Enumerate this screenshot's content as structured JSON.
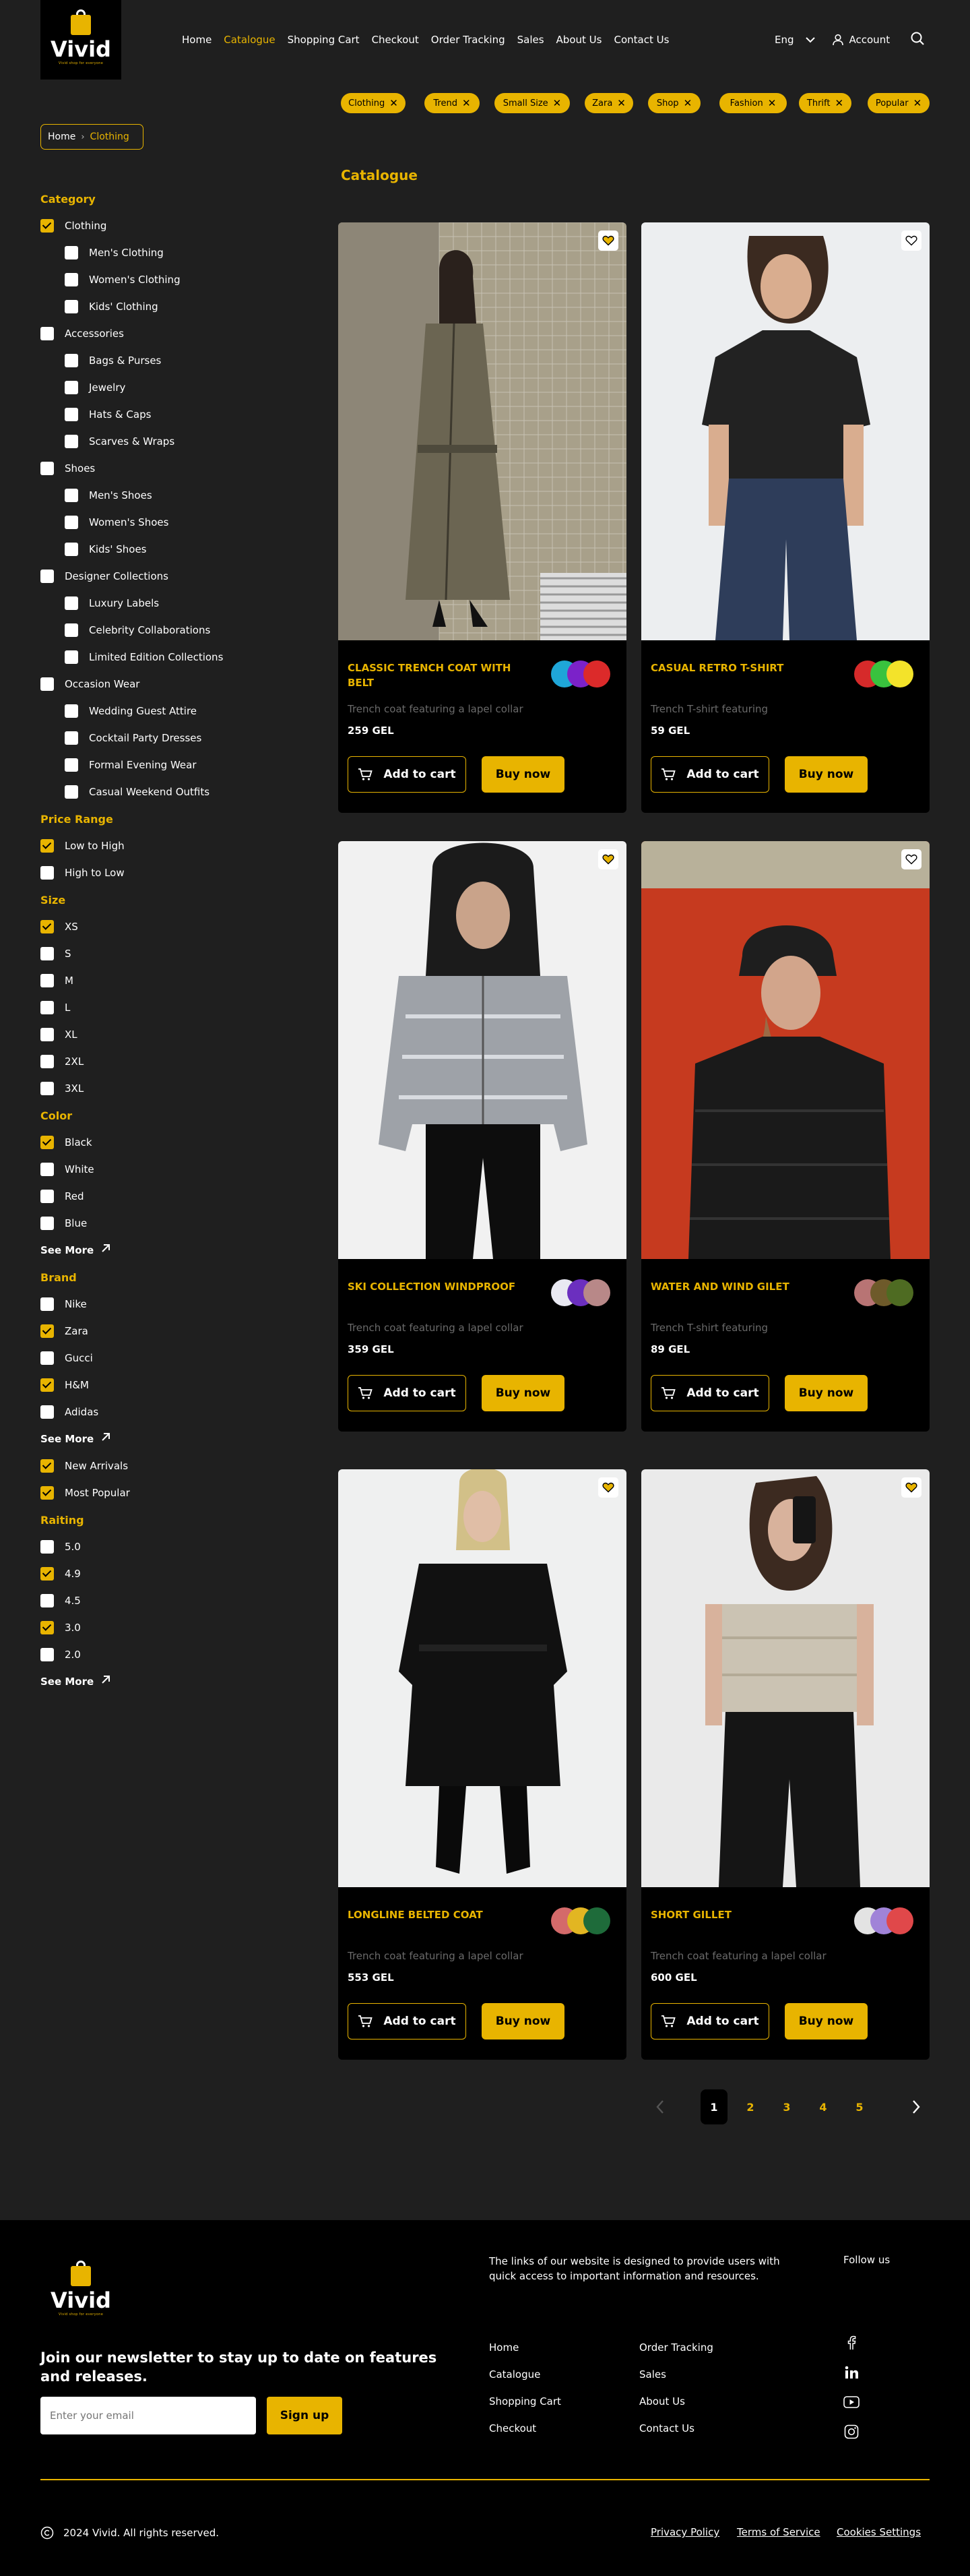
{
  "brand": {
    "name": "Vivid",
    "tagline": "Vivid shop for everyone"
  },
  "nav": {
    "items": [
      {
        "label": "Home",
        "active": false
      },
      {
        "label": "Catalogue",
        "active": true
      },
      {
        "label": "Shopping Cart",
        "active": false
      },
      {
        "label": "Checkout",
        "active": false
      },
      {
        "label": "Order Tracking",
        "active": false
      },
      {
        "label": "Sales",
        "active": false
      },
      {
        "label": "About Us",
        "active": false
      },
      {
        "label": "Contact Us",
        "active": false
      }
    ],
    "language": "Eng",
    "account": "Account"
  },
  "tags": [
    "Clothing",
    "Trend",
    "Small Size",
    "Zara",
    "Shop",
    "Fashion",
    "Thrift",
    "Popular"
  ],
  "breadcrumb": {
    "home": "Home",
    "current": "Clothing"
  },
  "filters": {
    "category_title": "Category",
    "category": [
      {
        "label": "Clothing",
        "checked": true,
        "sub": false
      },
      {
        "label": "Men's Clothing",
        "checked": false,
        "sub": true
      },
      {
        "label": "Women's Clothing",
        "checked": false,
        "sub": true
      },
      {
        "label": "Kids' Clothing",
        "checked": false,
        "sub": true
      },
      {
        "label": "Accessories",
        "checked": false,
        "sub": false
      },
      {
        "label": "Bags & Purses",
        "checked": false,
        "sub": true
      },
      {
        "label": "Jewelry",
        "checked": false,
        "sub": true
      },
      {
        "label": "Hats & Caps",
        "checked": false,
        "sub": true
      },
      {
        "label": "Scarves & Wraps",
        "checked": false,
        "sub": true
      },
      {
        "label": "Shoes",
        "checked": false,
        "sub": false
      },
      {
        "label": "Men's Shoes",
        "checked": false,
        "sub": true
      },
      {
        "label": "Women's Shoes",
        "checked": false,
        "sub": true
      },
      {
        "label": "Kids' Shoes",
        "checked": false,
        "sub": true
      },
      {
        "label": "Designer Collections",
        "checked": false,
        "sub": false
      },
      {
        "label": "Luxury Labels",
        "checked": false,
        "sub": true
      },
      {
        "label": "Celebrity Collaborations",
        "checked": false,
        "sub": true
      },
      {
        "label": "Limited Edition Collections",
        "checked": false,
        "sub": true
      },
      {
        "label": "Occasion Wear",
        "checked": false,
        "sub": false
      },
      {
        "label": "Wedding Guest Attire",
        "checked": false,
        "sub": true
      },
      {
        "label": "Cocktail Party Dresses",
        "checked": false,
        "sub": true
      },
      {
        "label": "Formal Evening Wear",
        "checked": false,
        "sub": true
      },
      {
        "label": "Casual Weekend Outfits",
        "checked": false,
        "sub": true
      }
    ],
    "price_title": "Price Range",
    "price": [
      {
        "label": "Low to High",
        "checked": true
      },
      {
        "label": "High to Low",
        "checked": false
      }
    ],
    "size_title": "Size",
    "size": [
      {
        "label": "XS",
        "checked": true
      },
      {
        "label": "S",
        "checked": false
      },
      {
        "label": "M",
        "checked": false
      },
      {
        "label": "L",
        "checked": false
      },
      {
        "label": "XL",
        "checked": false
      },
      {
        "label": "2XL",
        "checked": false
      },
      {
        "label": "3XL",
        "checked": false
      }
    ],
    "color_title": "Color",
    "color": [
      {
        "label": "Black",
        "checked": true
      },
      {
        "label": "White",
        "checked": false
      },
      {
        "label": "Red",
        "checked": false
      },
      {
        "label": "Blue",
        "checked": false
      }
    ],
    "brand_title": "Brand",
    "brand": [
      {
        "label": "Nike",
        "checked": false
      },
      {
        "label": "Zara",
        "checked": true
      },
      {
        "label": "Gucci",
        "checked": false
      },
      {
        "label": "H&M",
        "checked": true
      },
      {
        "label": "Adidas",
        "checked": false
      }
    ],
    "extra": [
      {
        "label": "New Arrivals",
        "checked": true
      },
      {
        "label": "Most Popular",
        "checked": true
      }
    ],
    "rating_title": "Raiting",
    "rating": [
      {
        "label": "5.0",
        "checked": false
      },
      {
        "label": "4.9",
        "checked": true
      },
      {
        "label": "4.5",
        "checked": false
      },
      {
        "label": "3.0",
        "checked": true
      },
      {
        "label": "2.0",
        "checked": false
      }
    ],
    "see_more": "See More"
  },
  "catalogue": {
    "title": "Catalogue",
    "add_to_cart": "Add to cart",
    "buy_now": "Buy now",
    "products": [
      {
        "title": "Classic Trench Coat with Belt",
        "desc": "Trench coat featuring a lapel collar",
        "price": "259 GEL",
        "favorite": true,
        "swatches": [
          "#1fa6d8",
          "#7b22c9",
          "#dc2a2a"
        ]
      },
      {
        "title": "Casual Retro T-Shirt",
        "desc": "Trench T-shirt featuring",
        "price": "59 GEL",
        "favorite": false,
        "swatches": [
          "#d62a2a",
          "#39c23e",
          "#f3e32a"
        ]
      },
      {
        "title": "Ski Collection Windproof",
        "desc": "Trench coat featuring a lapel collar",
        "price": "359 GEL",
        "favorite": true,
        "swatches": [
          "#e9e9f2",
          "#6b2fbf",
          "#b88888"
        ]
      },
      {
        "title": "Water and wind gilet",
        "desc": "Trench T-shirt featuring",
        "price": "89 GEL",
        "favorite": false,
        "swatches": [
          "#b87474",
          "#6e5a2a",
          "#4e6b22"
        ]
      },
      {
        "title": "Longline Belted  Coat",
        "desc": "Trench coat featuring a lapel collar",
        "price": "553 GEL",
        "favorite": true,
        "swatches": [
          "#d46a6a",
          "#e2b622",
          "#1e6b3a"
        ]
      },
      {
        "title": "Short Gillet",
        "desc": "Trench coat featuring a lapel collar",
        "price": "600 GEL",
        "favorite": true,
        "swatches": [
          "#e3e3e3",
          "#a083d8",
          "#e0484a"
        ]
      }
    ]
  },
  "pagination": {
    "pages": [
      "1",
      "2",
      "3",
      "4",
      "5"
    ],
    "current": "1"
  },
  "footer": {
    "newsletter_title": "Join our newsletter to stay up to date on features and releases.",
    "email_placeholder": "Enter your email",
    "signup": "Sign up",
    "links_intro": "The links of our website is designed to provide users with quick access to important information and resources.",
    "links": [
      "Home",
      "Catalogue",
      "Shopping Cart",
      "Checkout",
      "Order Tracking",
      "Sales",
      "About Us",
      "Contact Us"
    ],
    "follow": "Follow us",
    "social": [
      "facebook-icon",
      "linkedin-icon",
      "youtube-icon",
      "instagram-icon"
    ],
    "copyright": "2024 Vivid. All rights reserved.",
    "legal": [
      "Privacy Policy",
      "Terms of Service",
      "Cookies Settings"
    ]
  },
  "colors": {
    "accent": "#e8b400",
    "background": "#1f1f1f",
    "card": "#000000"
  }
}
